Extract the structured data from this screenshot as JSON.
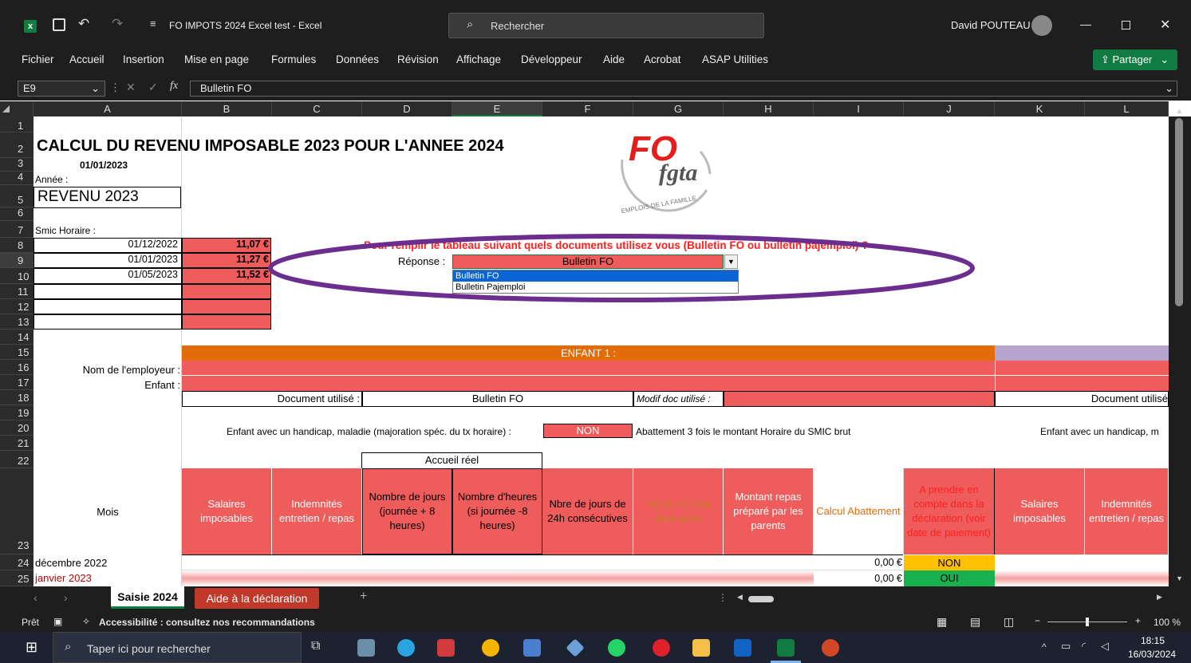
{
  "window": {
    "app_icon": "x",
    "title": "FO IMPOTS 2024 Excel test  -  Excel",
    "search_placeholder": "Rechercher",
    "user": "David POUTEAU"
  },
  "ribbon": {
    "tabs": [
      "Fichier",
      "Accueil",
      "Insertion",
      "Mise en page",
      "Formules",
      "Données",
      "Révision",
      "Affichage",
      "Développeur",
      "Aide",
      "Acrobat",
      "ASAP Utilities"
    ],
    "share": "Partager"
  },
  "formula_bar": {
    "cell_ref": "E9",
    "fx": "fx",
    "value": "Bulletin FO"
  },
  "columns": [
    "A",
    "B",
    "C",
    "D",
    "E",
    "F",
    "G",
    "H",
    "I",
    "J",
    "K",
    "L"
  ],
  "rows": [
    "1",
    "2",
    "3",
    "4",
    "5",
    "6",
    "7",
    "8",
    "9",
    "10",
    "11",
    "12",
    "13",
    "14",
    "15",
    "16",
    "17",
    "18",
    "19",
    "20",
    "21",
    "22",
    "23",
    "24",
    "25"
  ],
  "sheet": {
    "title": "CALCUL DU REVENU IMPOSABLE 2023 POUR L'ANNEE 2024",
    "date": "01/01/2023",
    "annee_label": "Année :",
    "revenu": "REVENU 2023",
    "smic_label": "Smic Horaire :",
    "smic_rows": [
      {
        "date": "01/12/2022",
        "value": "11,07 €"
      },
      {
        "date": "01/01/2023",
        "value": "11,27 €"
      },
      {
        "date": "01/05/2023",
        "value": "11,52 €"
      }
    ],
    "logo_text": "FO",
    "logo_sub": "fgta",
    "logo_ring": "EMPLOIS DE LA FAMILLE",
    "question": "Pour remplir le tableau suivant quels documents utilisez vous (Bulletin FO ou bulletin pajemploi) ?",
    "reponse_label": "Réponse :",
    "reponse_value": "Bulletin FO",
    "dropdown_options": [
      "Bulletin FO",
      "Bulletin Pajemploi"
    ],
    "enfant1": "ENFANT 1 :",
    "nom_employeur": "Nom de l'employeur :",
    "enfant": "Enfant :",
    "document_utilise": "Document utilisé :",
    "document_value": "Bulletin FO",
    "modif_doc": "Modif doc utilisé :",
    "document_utilise2": "Document utilisé",
    "handicap": "Enfant avec un handicap, maladie (majoration spéc. du tx horaire) :",
    "handicap_value": "NON",
    "abattement": "Abattement 3 fois le montant Horaire du SMIC brut",
    "handicap2": "Enfant avec un handicap, m",
    "accueil": "Accueil réel",
    "mois": "Mois",
    "headers": [
      "Salaires imposables",
      "Indemnités entretien / repas",
      "Nombre de jours (journée + 8 heures)",
      "Nombre d'heures (si journée -8 heures)",
      "Nbre de jours de 24h consécutives",
      "HS et HC non imposable",
      "Montant repas préparé par les parents",
      "Calcul Abattement",
      "A prendre en compte dans la déclaration (voir date de paiement)",
      "Salaires imposables",
      "Indemnités entretien / repas"
    ],
    "data_rows": [
      {
        "mois": "décembre 2022",
        "calcul": "0,00 €",
        "prendre": "NON"
      },
      {
        "mois": "janvier 2023",
        "calcul": "0,00 €",
        "prendre": "OUI"
      }
    ]
  },
  "sheet_tabs": [
    "Saisie 2024",
    "Aide à la déclaration",
    "+"
  ],
  "status": {
    "ready": "Prêt",
    "accessibility": "Accessibilité : consultez nos recommandations",
    "zoom": "100 %"
  },
  "taskbar": {
    "search_placeholder": "Taper ici pour rechercher",
    "time": "18:15",
    "date": "16/03/2024"
  },
  "colors": {
    "accent_green": "#107c41",
    "red_fill": "#ee5c5c",
    "orange_fill": "#e36c0a",
    "purple_ring": "#6b2e8e"
  }
}
